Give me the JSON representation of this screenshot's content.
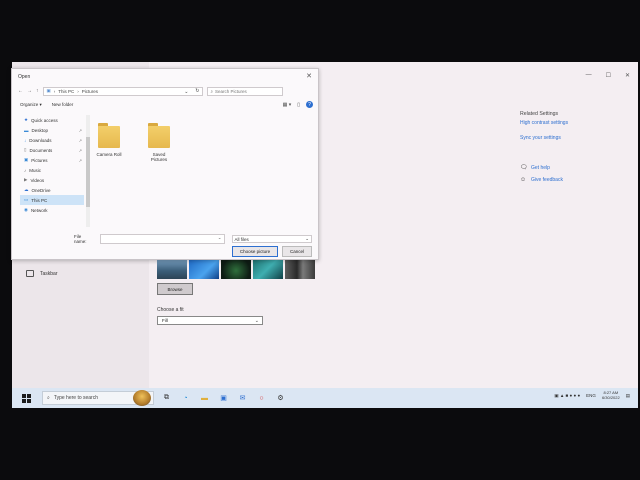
{
  "settings": {
    "window_controls": [
      "—",
      "☐",
      "✕"
    ],
    "left_nav": {
      "taskbar_label": "Taskbar"
    },
    "related": {
      "heading": "Related Settings",
      "links": [
        "High contrast settings",
        "Sync your settings"
      ]
    },
    "help": {
      "get_help": "Get help",
      "give_feedback": "Give feedback"
    },
    "browse_label": "Browse",
    "choose_fit_label": "Choose a fit",
    "fit_value": "Fill"
  },
  "dialog": {
    "title": "Open",
    "breadcrumb": [
      "This PC",
      "Pictures"
    ],
    "search_placeholder": "Search Pictures",
    "toolbar": {
      "organize": "Organize ▾",
      "new_folder": "New folder"
    },
    "nav_items": [
      {
        "label": "Quick access",
        "icon": "star-icon",
        "pinned": false
      },
      {
        "label": "Desktop",
        "icon": "desktop-icon",
        "pinned": true
      },
      {
        "label": "Downloads",
        "icon": "download-icon",
        "pinned": true
      },
      {
        "label": "Documents",
        "icon": "document-icon",
        "pinned": true
      },
      {
        "label": "Pictures",
        "icon": "pictures-icon",
        "pinned": true
      },
      {
        "label": "Music",
        "icon": "music-icon",
        "pinned": false
      },
      {
        "label": "Videos",
        "icon": "video-icon",
        "pinned": false
      },
      {
        "label": "OneDrive",
        "icon": "cloud-icon",
        "pinned": false
      },
      {
        "label": "This PC",
        "icon": "computer-icon",
        "pinned": false
      },
      {
        "label": "Network",
        "icon": "network-icon",
        "pinned": false
      }
    ],
    "folders": [
      "Camera Roll",
      "Saved Pictures"
    ],
    "file_name_label": "File name:",
    "file_name_value": "",
    "file_filter": "All files",
    "choose_button": "Choose picture",
    "cancel_button": "Cancel"
  },
  "taskbar": {
    "search_placeholder": "Type here to search",
    "tray": {
      "time": "8:27 AM",
      "date": "6/30/2022",
      "lang": "ENG"
    }
  },
  "colors": {
    "accent": "#2d6fd0",
    "folder": "#e6b84e",
    "taskbar": "#dbe6f3"
  }
}
